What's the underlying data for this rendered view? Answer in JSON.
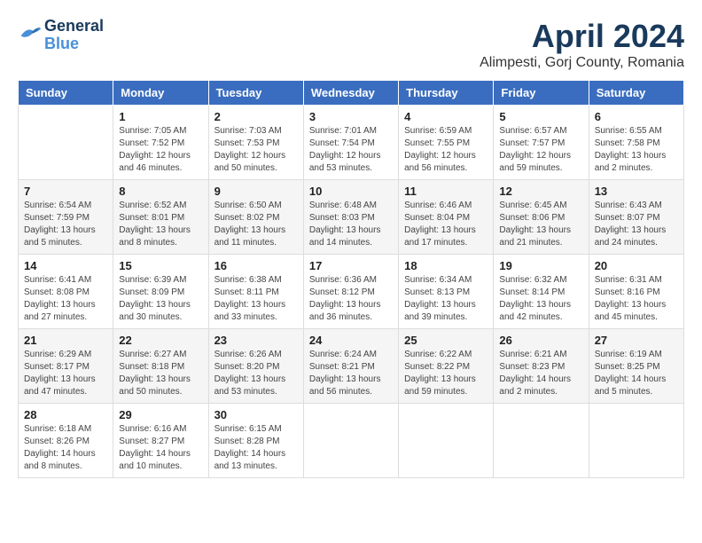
{
  "logo": {
    "line1": "General",
    "line2": "Blue"
  },
  "title": "April 2024",
  "location": "Alimpesti, Gorj County, Romania",
  "weekdays": [
    "Sunday",
    "Monday",
    "Tuesday",
    "Wednesday",
    "Thursday",
    "Friday",
    "Saturday"
  ],
  "weeks": [
    [
      {
        "day": "",
        "sunrise": "",
        "sunset": "",
        "daylight": ""
      },
      {
        "day": "1",
        "sunrise": "Sunrise: 7:05 AM",
        "sunset": "Sunset: 7:52 PM",
        "daylight": "Daylight: 12 hours and 46 minutes."
      },
      {
        "day": "2",
        "sunrise": "Sunrise: 7:03 AM",
        "sunset": "Sunset: 7:53 PM",
        "daylight": "Daylight: 12 hours and 50 minutes."
      },
      {
        "day": "3",
        "sunrise": "Sunrise: 7:01 AM",
        "sunset": "Sunset: 7:54 PM",
        "daylight": "Daylight: 12 hours and 53 minutes."
      },
      {
        "day": "4",
        "sunrise": "Sunrise: 6:59 AM",
        "sunset": "Sunset: 7:55 PM",
        "daylight": "Daylight: 12 hours and 56 minutes."
      },
      {
        "day": "5",
        "sunrise": "Sunrise: 6:57 AM",
        "sunset": "Sunset: 7:57 PM",
        "daylight": "Daylight: 12 hours and 59 minutes."
      },
      {
        "day": "6",
        "sunrise": "Sunrise: 6:55 AM",
        "sunset": "Sunset: 7:58 PM",
        "daylight": "Daylight: 13 hours and 2 minutes."
      }
    ],
    [
      {
        "day": "7",
        "sunrise": "Sunrise: 6:54 AM",
        "sunset": "Sunset: 7:59 PM",
        "daylight": "Daylight: 13 hours and 5 minutes."
      },
      {
        "day": "8",
        "sunrise": "Sunrise: 6:52 AM",
        "sunset": "Sunset: 8:01 PM",
        "daylight": "Daylight: 13 hours and 8 minutes."
      },
      {
        "day": "9",
        "sunrise": "Sunrise: 6:50 AM",
        "sunset": "Sunset: 8:02 PM",
        "daylight": "Daylight: 13 hours and 11 minutes."
      },
      {
        "day": "10",
        "sunrise": "Sunrise: 6:48 AM",
        "sunset": "Sunset: 8:03 PM",
        "daylight": "Daylight: 13 hours and 14 minutes."
      },
      {
        "day": "11",
        "sunrise": "Sunrise: 6:46 AM",
        "sunset": "Sunset: 8:04 PM",
        "daylight": "Daylight: 13 hours and 17 minutes."
      },
      {
        "day": "12",
        "sunrise": "Sunrise: 6:45 AM",
        "sunset": "Sunset: 8:06 PM",
        "daylight": "Daylight: 13 hours and 21 minutes."
      },
      {
        "day": "13",
        "sunrise": "Sunrise: 6:43 AM",
        "sunset": "Sunset: 8:07 PM",
        "daylight": "Daylight: 13 hours and 24 minutes."
      }
    ],
    [
      {
        "day": "14",
        "sunrise": "Sunrise: 6:41 AM",
        "sunset": "Sunset: 8:08 PM",
        "daylight": "Daylight: 13 hours and 27 minutes."
      },
      {
        "day": "15",
        "sunrise": "Sunrise: 6:39 AM",
        "sunset": "Sunset: 8:09 PM",
        "daylight": "Daylight: 13 hours and 30 minutes."
      },
      {
        "day": "16",
        "sunrise": "Sunrise: 6:38 AM",
        "sunset": "Sunset: 8:11 PM",
        "daylight": "Daylight: 13 hours and 33 minutes."
      },
      {
        "day": "17",
        "sunrise": "Sunrise: 6:36 AM",
        "sunset": "Sunset: 8:12 PM",
        "daylight": "Daylight: 13 hours and 36 minutes."
      },
      {
        "day": "18",
        "sunrise": "Sunrise: 6:34 AM",
        "sunset": "Sunset: 8:13 PM",
        "daylight": "Daylight: 13 hours and 39 minutes."
      },
      {
        "day": "19",
        "sunrise": "Sunrise: 6:32 AM",
        "sunset": "Sunset: 8:14 PM",
        "daylight": "Daylight: 13 hours and 42 minutes."
      },
      {
        "day": "20",
        "sunrise": "Sunrise: 6:31 AM",
        "sunset": "Sunset: 8:16 PM",
        "daylight": "Daylight: 13 hours and 45 minutes."
      }
    ],
    [
      {
        "day": "21",
        "sunrise": "Sunrise: 6:29 AM",
        "sunset": "Sunset: 8:17 PM",
        "daylight": "Daylight: 13 hours and 47 minutes."
      },
      {
        "day": "22",
        "sunrise": "Sunrise: 6:27 AM",
        "sunset": "Sunset: 8:18 PM",
        "daylight": "Daylight: 13 hours and 50 minutes."
      },
      {
        "day": "23",
        "sunrise": "Sunrise: 6:26 AM",
        "sunset": "Sunset: 8:20 PM",
        "daylight": "Daylight: 13 hours and 53 minutes."
      },
      {
        "day": "24",
        "sunrise": "Sunrise: 6:24 AM",
        "sunset": "Sunset: 8:21 PM",
        "daylight": "Daylight: 13 hours and 56 minutes."
      },
      {
        "day": "25",
        "sunrise": "Sunrise: 6:22 AM",
        "sunset": "Sunset: 8:22 PM",
        "daylight": "Daylight: 13 hours and 59 minutes."
      },
      {
        "day": "26",
        "sunrise": "Sunrise: 6:21 AM",
        "sunset": "Sunset: 8:23 PM",
        "daylight": "Daylight: 14 hours and 2 minutes."
      },
      {
        "day": "27",
        "sunrise": "Sunrise: 6:19 AM",
        "sunset": "Sunset: 8:25 PM",
        "daylight": "Daylight: 14 hours and 5 minutes."
      }
    ],
    [
      {
        "day": "28",
        "sunrise": "Sunrise: 6:18 AM",
        "sunset": "Sunset: 8:26 PM",
        "daylight": "Daylight: 14 hours and 8 minutes."
      },
      {
        "day": "29",
        "sunrise": "Sunrise: 6:16 AM",
        "sunset": "Sunset: 8:27 PM",
        "daylight": "Daylight: 14 hours and 10 minutes."
      },
      {
        "day": "30",
        "sunrise": "Sunrise: 6:15 AM",
        "sunset": "Sunset: 8:28 PM",
        "daylight": "Daylight: 14 hours and 13 minutes."
      },
      {
        "day": "",
        "sunrise": "",
        "sunset": "",
        "daylight": ""
      },
      {
        "day": "",
        "sunrise": "",
        "sunset": "",
        "daylight": ""
      },
      {
        "day": "",
        "sunrise": "",
        "sunset": "",
        "daylight": ""
      },
      {
        "day": "",
        "sunrise": "",
        "sunset": "",
        "daylight": ""
      }
    ]
  ]
}
